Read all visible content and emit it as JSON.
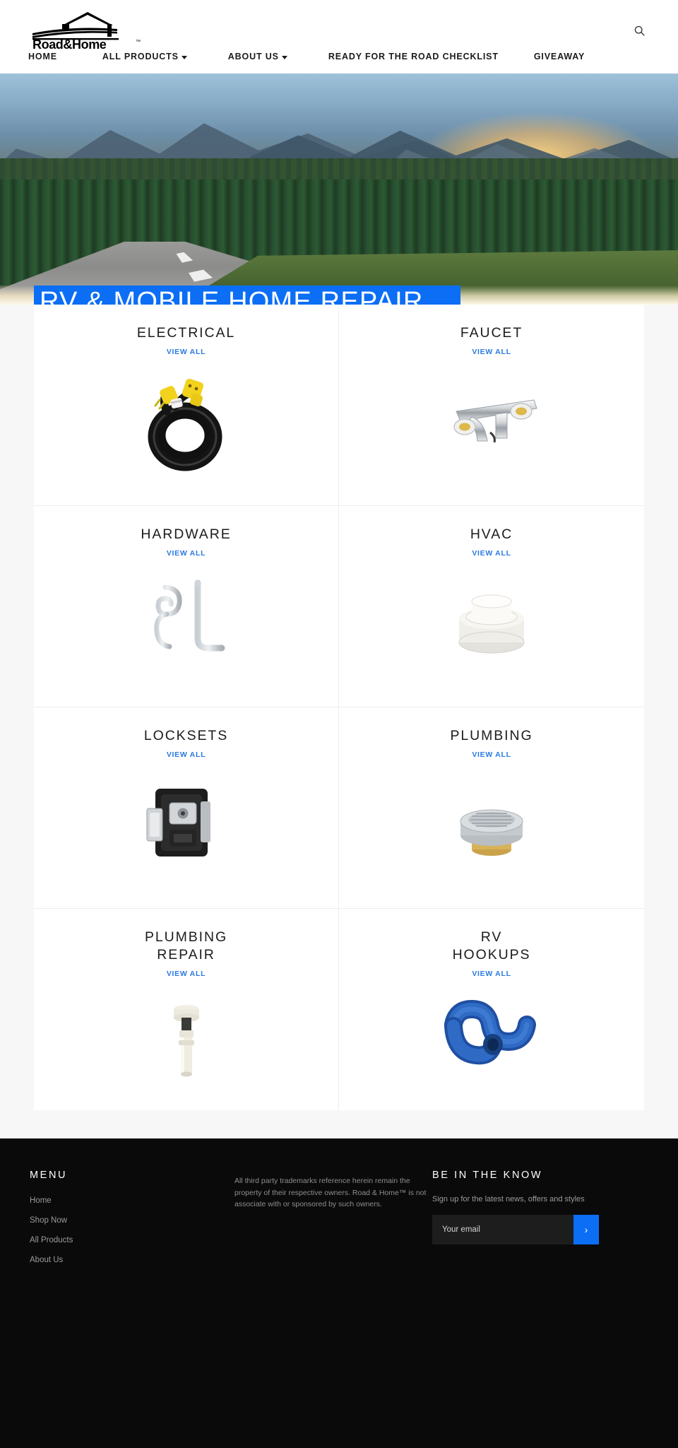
{
  "header": {
    "logo_text": "Road & Home",
    "logo_tm": "™",
    "search_icon": "search-icon",
    "nav": [
      {
        "label": "HOME",
        "has_dropdown": false
      },
      {
        "label": "ALL PRODUCTS",
        "has_dropdown": true
      },
      {
        "label": "ABOUT US",
        "has_dropdown": true
      },
      {
        "label": "READY FOR THE ROAD CHECKLIST",
        "has_dropdown": false
      },
      {
        "label": "GIVEAWAY",
        "has_dropdown": false
      }
    ]
  },
  "hero": {
    "title": "RV & MOBILE HOME REPAIR PARTS",
    "title_bg_color": "#0b6ef5",
    "title_color": "#ffffff",
    "prev_label": "‹",
    "next_label": "›"
  },
  "categories": {
    "view_all_label": "VIEW ALL",
    "items": [
      {
        "title": "ELECTRICAL",
        "image": "power-cord-image"
      },
      {
        "title": "FAUCET",
        "image": "faucet-image"
      },
      {
        "title": "HARDWARE",
        "image": "hitch-pin-image"
      },
      {
        "title": "HVAC",
        "image": "vent-cap-image"
      },
      {
        "title": "LOCKSETS",
        "image": "door-lock-image"
      },
      {
        "title": "PLUMBING",
        "image": "shower-drain-image"
      },
      {
        "title": "PLUMBING\nREPAIR",
        "image": "drain-tailpiece-image"
      },
      {
        "title": "RV\nHOOKUPS",
        "image": "sewer-hose-image"
      }
    ]
  },
  "footer": {
    "menu_heading": "MENU",
    "menu_links": [
      "Home",
      "Shop Now",
      "All Products",
      "About Us"
    ],
    "legal_text": "All third party trademarks reference herein remain the property of their respective owners. Road & Home™ is not associate with or sponsored by such owners.",
    "newsletter_heading": "BE IN THE KNOW",
    "newsletter_sub": "Sign up for the latest news, offers and styles",
    "email_placeholder": "Your email",
    "submit_label": "›",
    "accent_color": "#0b6ef5"
  }
}
